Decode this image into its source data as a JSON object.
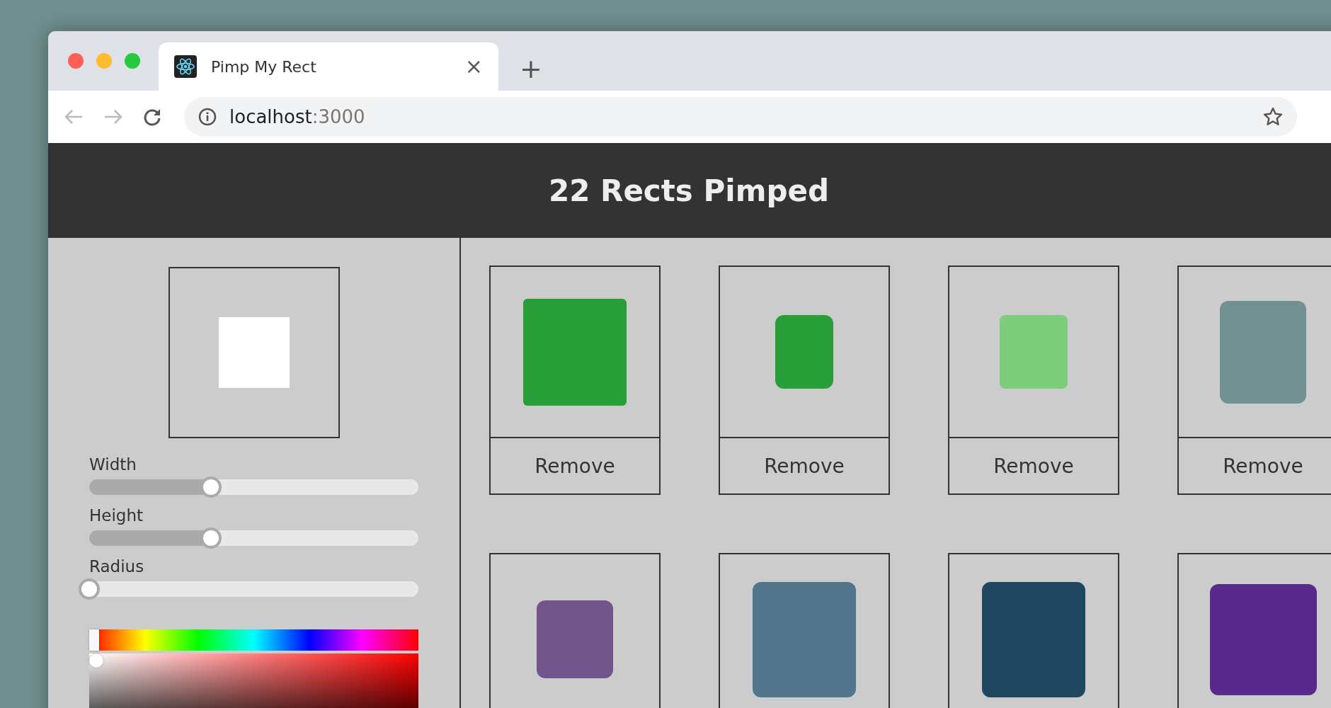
{
  "browser": {
    "tab": {
      "title": "Pimp My Rect",
      "close": "×"
    },
    "new_tab": "+",
    "address": {
      "host": "localhost",
      "port": ":3000"
    }
  },
  "header": {
    "title": "22 Rects Pimped"
  },
  "editor": {
    "sliders": [
      {
        "label": "Width",
        "level": 0.37
      },
      {
        "label": "Height",
        "level": 0.37
      },
      {
        "label": "Radius",
        "level": 0
      }
    ]
  },
  "rects": [
    {
      "color": "#279e38",
      "button": "Remove"
    },
    {
      "color": "#279e38",
      "button": "Remove"
    },
    {
      "color": "#7dcd7d",
      "button": "Remove"
    },
    {
      "color": "#719191",
      "button": "Remove"
    },
    {
      "color": "#70548a"
    },
    {
      "color": "#52768c"
    },
    {
      "color": "#1f4760"
    },
    {
      "color": "#582a8b"
    }
  ]
}
